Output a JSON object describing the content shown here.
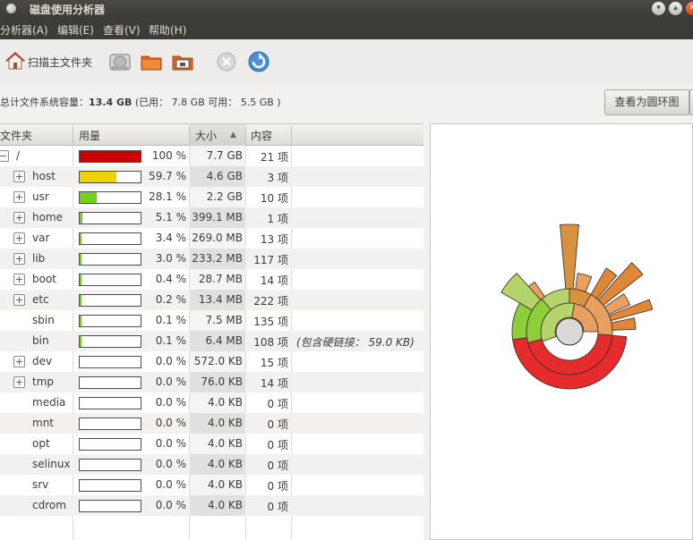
{
  "window": {
    "title": "磁盘使用分析器"
  },
  "menu": [
    "分析器(A)",
    "编辑(E)",
    "查看(V)",
    "帮助(H)"
  ],
  "toolbar": {
    "scan_home_label": "扫描主文件夹"
  },
  "capacity": {
    "label": "总计文件系统容量：",
    "total": "13.4 GB",
    "detail": "(已用： 7.8 GB 可用： 5.5 GB )"
  },
  "view_ring_button": "查看为圆环图",
  "table": {
    "headers": {
      "folder": "文件夹",
      "usage": "用量",
      "size": "大小",
      "items": "内容"
    },
    "rows": [
      {
        "name": "/",
        "pct": "100 %",
        "size": "7.7 GB",
        "items": "21 项",
        "expander": "−",
        "fill": 1.0,
        "color": "#cc0000",
        "note": ""
      },
      {
        "name": "host",
        "pct": "59.7 %",
        "size": "4.6 GB",
        "items": "3 项",
        "expander": "+",
        "fill": 0.597,
        "color": "#edd400",
        "note": ""
      },
      {
        "name": "usr",
        "pct": "28.1 %",
        "size": "2.2 GB",
        "items": "10 项",
        "expander": "+",
        "fill": 0.281,
        "color": "#73d216",
        "note": ""
      },
      {
        "name": "home",
        "pct": "5.1 %",
        "size": "399.1 MB",
        "items": "1 项",
        "expander": "+",
        "fill": 0.051,
        "color": "#73d216",
        "note": ""
      },
      {
        "name": "var",
        "pct": "3.4 %",
        "size": "269.0 MB",
        "items": "13 项",
        "expander": "+",
        "fill": 0.034,
        "color": "#73d216",
        "note": ""
      },
      {
        "name": "lib",
        "pct": "3.0 %",
        "size": "233.2 MB",
        "items": "117 项",
        "expander": "+",
        "fill": 0.03,
        "color": "#73d216",
        "note": ""
      },
      {
        "name": "boot",
        "pct": "0.4 %",
        "size": "28.7 MB",
        "items": "14 项",
        "expander": "+",
        "fill": 0.004,
        "color": "#73d216",
        "note": ""
      },
      {
        "name": "etc",
        "pct": "0.2 %",
        "size": "13.4 MB",
        "items": "222 项",
        "expander": "+",
        "fill": 0.002,
        "color": "#73d216",
        "note": ""
      },
      {
        "name": "sbin",
        "pct": "0.1 %",
        "size": "7.5 MB",
        "items": "135 项",
        "expander": "",
        "fill": 0.001,
        "color": "#73d216",
        "note": ""
      },
      {
        "name": "bin",
        "pct": "0.1 %",
        "size": "6.4 MB",
        "items": "108 项",
        "expander": "",
        "fill": 0.001,
        "color": "#73d216",
        "note": "(包含硬链接： 59.0 KB)"
      },
      {
        "name": "dev",
        "pct": "0.0 %",
        "size": "572.0 KB",
        "items": "15 项",
        "expander": "+",
        "fill": 0,
        "color": "#73d216",
        "note": ""
      },
      {
        "name": "tmp",
        "pct": "0.0 %",
        "size": "76.0 KB",
        "items": "14 项",
        "expander": "+",
        "fill": 0,
        "color": "#73d216",
        "note": ""
      },
      {
        "name": "media",
        "pct": "0.0 %",
        "size": "4.0 KB",
        "items": "0 项",
        "expander": "",
        "fill": 0,
        "color": "#73d216",
        "note": ""
      },
      {
        "name": "mnt",
        "pct": "0.0 %",
        "size": "4.0 KB",
        "items": "0 项",
        "expander": "",
        "fill": 0,
        "color": "#73d216",
        "note": ""
      },
      {
        "name": "opt",
        "pct": "0.0 %",
        "size": "4.0 KB",
        "items": "0 项",
        "expander": "",
        "fill": 0,
        "color": "#73d216",
        "note": ""
      },
      {
        "name": "selinux",
        "pct": "0.0 %",
        "size": "4.0 KB",
        "items": "0 项",
        "expander": "",
        "fill": 0,
        "color": "#73d216",
        "note": ""
      },
      {
        "name": "srv",
        "pct": "0.0 %",
        "size": "4.0 KB",
        "items": "0 项",
        "expander": "",
        "fill": 0,
        "color": "#73d216",
        "note": ""
      },
      {
        "name": "cdrom",
        "pct": "0.0 %",
        "size": "4.0 KB",
        "items": "0 项",
        "expander": "",
        "fill": 0,
        "color": "#73d216",
        "note": ""
      }
    ]
  },
  "colors": {
    "root": "#e52b2b",
    "yellow": "#edd400",
    "green": "#73d216",
    "orange": "#e8883a"
  }
}
